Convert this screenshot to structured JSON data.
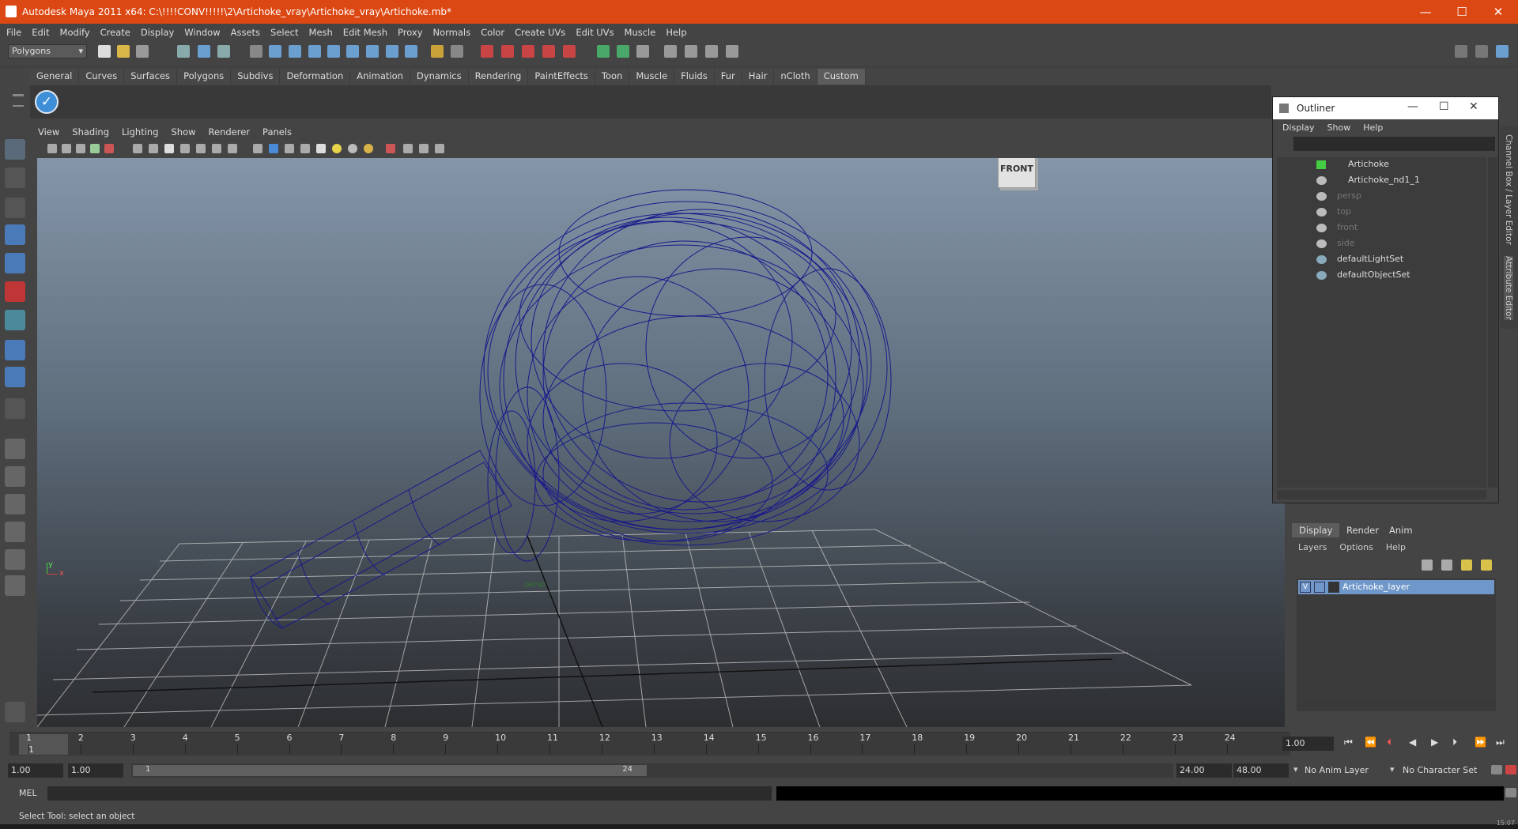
{
  "window": {
    "title": "Autodesk Maya 2011 x64: C:\\!!!!CONV!!!!!\\2\\Artichoke_vray\\Artichoke_vray\\Artichoke.mb*",
    "minimize": "—",
    "maximize": "☐",
    "close": "✕"
  },
  "menubar": [
    "File",
    "Edit",
    "Modify",
    "Create",
    "Display",
    "Window",
    "Assets",
    "Select",
    "Mesh",
    "Edit Mesh",
    "Proxy",
    "Normals",
    "Color",
    "Create UVs",
    "Edit UVs",
    "Muscle",
    "Help"
  ],
  "statusline": {
    "mode": "Polygons"
  },
  "shelf_tabs": [
    "General",
    "Curves",
    "Surfaces",
    "Polygons",
    "Subdivs",
    "Deformation",
    "Animation",
    "Dynamics",
    "Rendering",
    "PaintEffects",
    "Toon",
    "Muscle",
    "Fluids",
    "Fur",
    "Hair",
    "nCloth",
    "Custom"
  ],
  "shelf_active": "Custom",
  "viewport": {
    "menu": [
      "View",
      "Shading",
      "Lighting",
      "Show",
      "Renderer",
      "Panels"
    ],
    "view_cube_label": "FRONT",
    "camera_label": "persp",
    "axis_x": "x",
    "axis_y": "y",
    "wireframe_color": "#1a1a8a"
  },
  "outliner": {
    "title": "Outliner",
    "menu": [
      "Display",
      "Show",
      "Help"
    ],
    "items": [
      {
        "label": "Artichoke",
        "dim": false
      },
      {
        "label": "Artichoke_nd1_1",
        "dim": false
      },
      {
        "label": "persp",
        "dim": true
      },
      {
        "label": "top",
        "dim": true
      },
      {
        "label": "front",
        "dim": true
      },
      {
        "label": "side",
        "dim": true
      },
      {
        "label": "defaultLightSet",
        "dim": false
      },
      {
        "label": "defaultObjectSet",
        "dim": false
      }
    ]
  },
  "side_tabs": {
    "channel_box": "Channel Box / Layer Editor",
    "attribute_editor": "Attribute Editor"
  },
  "layer_editor": {
    "tabs": [
      "Display",
      "Render",
      "Anim"
    ],
    "menu": [
      "Layers",
      "Options",
      "Help"
    ],
    "layer": {
      "visible_flag": "V",
      "name": "Artichoke_layer"
    }
  },
  "timeline": {
    "ticks": [
      "1",
      "2",
      "3",
      "4",
      "5",
      "6",
      "7",
      "8",
      "9",
      "10",
      "11",
      "12",
      "13",
      "14",
      "15",
      "16",
      "17",
      "18",
      "19",
      "20",
      "21",
      "22",
      "23",
      "24"
    ],
    "current_frame": "1",
    "current_field": "1.00"
  },
  "range": {
    "start": "1.00",
    "playback_start": "1.00",
    "slider_start": "1",
    "slider_end": "24",
    "playback_end": "24.00",
    "end": "48.00",
    "anim_layer": "No Anim Layer",
    "character_set": "No Character Set"
  },
  "command": {
    "label": "MEL"
  },
  "helpline": "Select Tool: select an object",
  "taskbar_time": "15:07"
}
